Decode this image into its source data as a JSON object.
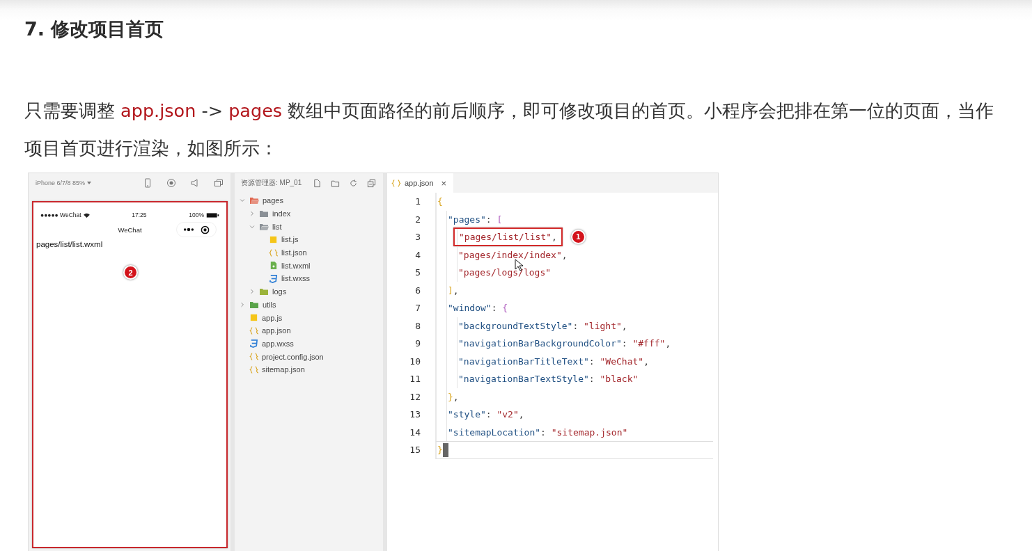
{
  "heading": "7. 修改项目首页",
  "paragraph": [
    {
      "kind": "plain",
      "text": "只需要调整 "
    },
    {
      "kind": "code",
      "text": "app.json"
    },
    {
      "kind": "plain",
      "text": " -> "
    },
    {
      "kind": "code",
      "text": "pages"
    },
    {
      "kind": "plain",
      "text": " 数组中页面路径的前后顺序，即可修改项目的首页。小程序会把排在第一位的页面，当作项目首页进行渲染，如图所示："
    }
  ],
  "simulator": {
    "device": "iPhone 6/7/8 85%",
    "carrier": "●●●●● WeChat",
    "time": "17:25",
    "battery": "100%",
    "nav_title": "WeChat",
    "page_text": "pages/list/list.wxml",
    "callout": "2"
  },
  "explorer": {
    "title": "资源管理器: MP_01",
    "tree": [
      {
        "name": "pages",
        "kind": "folder",
        "color": "#e0674f",
        "expanded": true,
        "children": [
          {
            "name": "index",
            "kind": "folder",
            "color": "#8a9096",
            "expanded": false
          },
          {
            "name": "list",
            "kind": "folder",
            "color": "#8a9096",
            "expanded": true,
            "children": [
              {
                "name": "list.js",
                "kind": "js"
              },
              {
                "name": "list.json",
                "kind": "json"
              },
              {
                "name": "list.wxml",
                "kind": "wxml"
              },
              {
                "name": "list.wxss",
                "kind": "wxss"
              }
            ]
          },
          {
            "name": "logs",
            "kind": "folder",
            "color": "#9bb33a",
            "expanded": false
          }
        ]
      },
      {
        "name": "utils",
        "kind": "folder",
        "color": "#5aa34a",
        "expanded": false
      },
      {
        "name": "app.js",
        "kind": "js"
      },
      {
        "name": "app.json",
        "kind": "json"
      },
      {
        "name": "app.wxss",
        "kind": "wxss"
      },
      {
        "name": "project.config.json",
        "kind": "json"
      },
      {
        "name": "sitemap.json",
        "kind": "json"
      }
    ]
  },
  "editor": {
    "tab": {
      "label": "app.json",
      "close": "×"
    },
    "callout": "1",
    "lines": [
      {
        "number": "1",
        "marked": false,
        "current": false,
        "tokens": [
          {
            "kind": "open",
            "text": "{"
          }
        ]
      },
      {
        "number": "2",
        "marked": false,
        "current": false,
        "tokens": [
          {
            "kind": "key",
            "text": "\"pages\""
          },
          {
            "kind": "punct",
            "text": ": "
          },
          {
            "kind": "open",
            "text": "["
          }
        ]
      },
      {
        "number": "3",
        "marked": true,
        "current": false,
        "tokens": [
          {
            "kind": "string",
            "text": "\"pages/list/list\""
          },
          {
            "kind": "punct",
            "text": ","
          }
        ]
      },
      {
        "number": "4",
        "marked": false,
        "current": false,
        "tokens": [
          {
            "kind": "string",
            "text": "\"pages/index/index\""
          },
          {
            "kind": "punct",
            "text": ","
          }
        ]
      },
      {
        "number": "5",
        "marked": false,
        "current": false,
        "tokens": [
          {
            "kind": "string",
            "text": "\"pages/logs/logs\""
          }
        ]
      },
      {
        "number": "6",
        "marked": false,
        "current": false,
        "tokens": [
          {
            "kind": "close",
            "text": "]"
          },
          {
            "kind": "punct",
            "text": ","
          }
        ]
      },
      {
        "number": "7",
        "marked": false,
        "current": false,
        "tokens": [
          {
            "kind": "key",
            "text": "\"window\""
          },
          {
            "kind": "punct",
            "text": ": "
          },
          {
            "kind": "open",
            "text": "{"
          }
        ]
      },
      {
        "number": "8",
        "marked": false,
        "current": false,
        "tokens": [
          {
            "kind": "key",
            "text": "\"backgroundTextStyle\""
          },
          {
            "kind": "punct",
            "text": ": "
          },
          {
            "kind": "string",
            "text": "\"light\""
          },
          {
            "kind": "punct",
            "text": ","
          }
        ]
      },
      {
        "number": "9",
        "marked": false,
        "current": false,
        "tokens": [
          {
            "kind": "key",
            "text": "\"navigationBarBackgroundColor\""
          },
          {
            "kind": "punct",
            "text": ": "
          },
          {
            "kind": "string",
            "text": "\"#fff\""
          },
          {
            "kind": "punct",
            "text": ","
          }
        ]
      },
      {
        "number": "10",
        "marked": false,
        "current": false,
        "tokens": [
          {
            "kind": "key",
            "text": "\"navigationBarTitleText\""
          },
          {
            "kind": "punct",
            "text": ": "
          },
          {
            "kind": "string",
            "text": "\"WeChat\""
          },
          {
            "kind": "punct",
            "text": ","
          }
        ]
      },
      {
        "number": "11",
        "marked": false,
        "current": false,
        "tokens": [
          {
            "kind": "key",
            "text": "\"navigationBarTextStyle\""
          },
          {
            "kind": "punct",
            "text": ": "
          },
          {
            "kind": "string",
            "text": "\"black\""
          }
        ]
      },
      {
        "number": "12",
        "marked": false,
        "current": false,
        "tokens": [
          {
            "kind": "close",
            "text": "}"
          },
          {
            "kind": "punct",
            "text": ","
          }
        ]
      },
      {
        "number": "13",
        "marked": false,
        "current": false,
        "tokens": [
          {
            "kind": "key",
            "text": "\"style\""
          },
          {
            "kind": "punct",
            "text": ": "
          },
          {
            "kind": "string",
            "text": "\"v2\""
          },
          {
            "kind": "punct",
            "text": ","
          }
        ]
      },
      {
        "number": "14",
        "marked": false,
        "current": false,
        "tokens": [
          {
            "kind": "key",
            "text": "\"sitemapLocation\""
          },
          {
            "kind": "punct",
            "text": ": "
          },
          {
            "kind": "string",
            "text": "\"sitemap.json\""
          }
        ]
      },
      {
        "number": "15",
        "marked": false,
        "current": true,
        "tokens": [
          {
            "kind": "close",
            "text": "}"
          }
        ]
      }
    ]
  }
}
